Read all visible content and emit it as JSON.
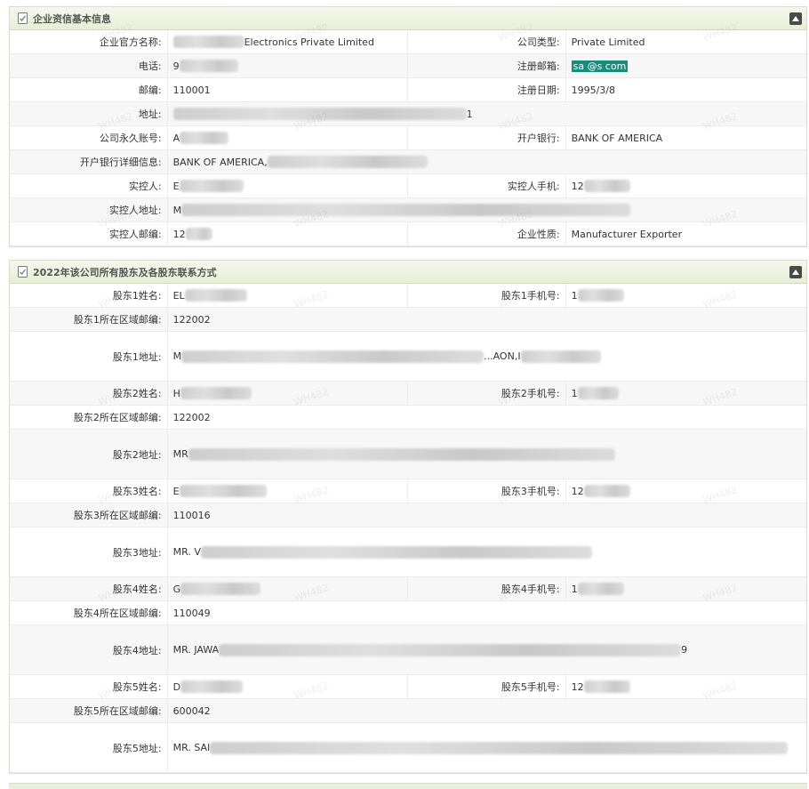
{
  "section1": {
    "title": "企业资信基本信息",
    "rows": [
      {
        "l1": "企业官方名称:",
        "v1": "Electronics Private Limited",
        "l2": "公司类型:",
        "v2": "Private Limited"
      },
      {
        "l1": "电话:",
        "v1": "9",
        "l2": "注册邮箱:",
        "v2": "sa        @s           com"
      },
      {
        "l1": "邮编:",
        "v1": "110001",
        "l2": "注册日期:",
        "v2": "1995/3/8"
      },
      {
        "l1": "地址:",
        "v1": "1"
      },
      {
        "l1": "公司永久账号:",
        "v1": "A",
        "l2": "开户银行:",
        "v2": "BANK OF AMERICA"
      },
      {
        "l1": "开户银行详细信息:",
        "v1": "BANK OF AMERICA,"
      },
      {
        "l1": "实控人:",
        "v1": "E",
        "l2": "实控人手机:",
        "v2": "12"
      },
      {
        "l1": "实控人地址:",
        "v1": "M"
      },
      {
        "l1": "实控人邮编:",
        "v1": "12",
        "l2": "企业性质:",
        "v2": "Manufacturer Exporter"
      }
    ]
  },
  "section2": {
    "title": "2022年该公司所有股东及各股东联系方式",
    "rows": [
      {
        "l1": "股东1姓名:",
        "v1": "EL",
        "l2": "股东1手机号:",
        "v2": "1"
      },
      {
        "l1": "股东1所在区域邮编:",
        "v1": "122002"
      },
      {
        "l1": "股东1地址:",
        "v1": "M",
        "tail": "...AON,I"
      },
      {
        "l1": "股东2姓名:",
        "v1": "H",
        "l2": "股东2手机号:",
        "v2": "1"
      },
      {
        "l1": "股东2所在区域邮编:",
        "v1": "122002"
      },
      {
        "l1": "股东2地址:",
        "v1": "MR"
      },
      {
        "l1": "股东3姓名:",
        "v1": "E",
        "l2": "股东3手机号:",
        "v2": "12"
      },
      {
        "l1": "股东3所在区域邮编:",
        "v1": "110016"
      },
      {
        "l1": "股东3地址:",
        "v1": "MR. V"
      },
      {
        "l1": "股东4姓名:",
        "v1": "G",
        "l2": "股东4手机号:",
        "v2": "1"
      },
      {
        "l1": "股东4所在区域邮编:",
        "v1": "110049"
      },
      {
        "l1": "股东4地址:",
        "v1": "MR. JAWA",
        "tail": "9"
      },
      {
        "l1": "股东5姓名:",
        "v1": "D",
        "l2": "股东5手机号:",
        "v2": "12"
      },
      {
        "l1": "股东5所在区域邮编:",
        "v1": "600042"
      },
      {
        "l1": "股东5地址:",
        "v1": "MR. SAI"
      }
    ]
  },
  "watermark_text": "WH482",
  "icons": {
    "section_icon": "document-check-icon",
    "collapse_icon": "triangle-up-icon"
  },
  "colors": {
    "header_bg": "#e7eed6",
    "email_highlight": "#1a8c7c",
    "border": "#d6ddc8"
  }
}
